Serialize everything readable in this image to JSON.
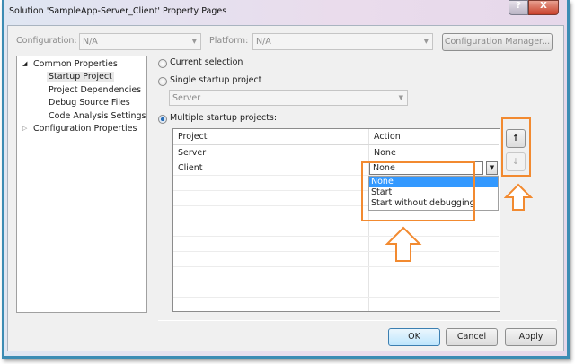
{
  "window": {
    "title": "Solution 'SampleApp-Server_Client' Property Pages",
    "help": "?",
    "close": "X"
  },
  "config": {
    "configuration_label": "Configuration:",
    "configuration_value": "N/A",
    "platform_label": "Platform:",
    "platform_value": "N/A",
    "manager_button": "Configuration Manager..."
  },
  "tree": {
    "common": "Common Properties",
    "children": [
      "Startup Project",
      "Project Dependencies",
      "Debug Source Files",
      "Code Analysis Settings"
    ],
    "configuration": "Configuration Properties"
  },
  "startup": {
    "current": "Current selection",
    "single": "Single startup project",
    "single_value": "Server",
    "multiple": "Multiple startup projects:",
    "selected": "multiple"
  },
  "grid": {
    "headers": [
      "Project",
      "Action"
    ],
    "rows": [
      {
        "project": "Server",
        "action": "None"
      },
      {
        "project": "Client",
        "action": "None"
      }
    ]
  },
  "dropdown": {
    "value": "None",
    "options": [
      "None",
      "Start",
      "Start without debugging"
    ],
    "highlighted": "None"
  },
  "buttons": {
    "up": "↑",
    "down": "↓",
    "ok": "OK",
    "cancel": "Cancel",
    "apply": "Apply"
  },
  "colors": {
    "highlight": "#3399ff",
    "annotation": "#f28a30"
  }
}
